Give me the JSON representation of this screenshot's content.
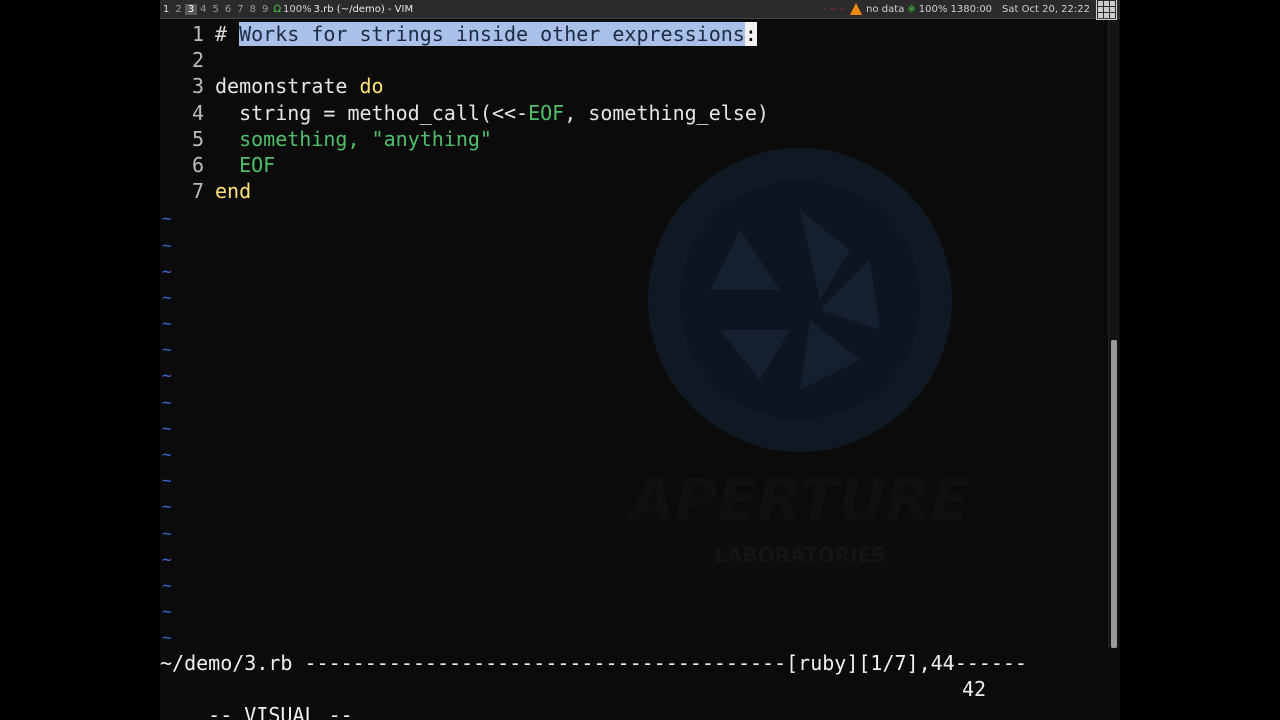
{
  "topbar": {
    "workspaces": [
      {
        "label": "1",
        "state": "occupied"
      },
      {
        "label": "2",
        "state": "normal"
      },
      {
        "label": "3",
        "state": "active"
      },
      {
        "label": "4",
        "state": "normal"
      },
      {
        "label": "5",
        "state": "normal"
      },
      {
        "label": "6",
        "state": "normal"
      },
      {
        "label": "7",
        "state": "normal"
      },
      {
        "label": "8",
        "state": "normal"
      },
      {
        "label": "9",
        "state": "normal"
      }
    ],
    "layout_icon": "layout-tall-icon",
    "master_ratio": "100%",
    "window_title": "3.rb (~/demo) - VIM",
    "cpu_graph_text": "- -- -",
    "media_icon": "vlc-cone-icon",
    "media_status": "no data",
    "battery_icon": "battery-plug-icon",
    "battery_text": "100% 1380:00",
    "clock": "Sat Oct 20, 22:22",
    "grid_icon": "grid-icon"
  },
  "editor": {
    "filetype": "ruby",
    "lines": [
      {
        "number": "1",
        "segments": [
          {
            "text": "# ",
            "class": "cm"
          },
          {
            "text": "Works for strings inside other expressions",
            "class": "sel"
          },
          {
            "text": ":",
            "class": "cursor-ch"
          },
          {
            "text": ":",
            "class": "cm"
          }
        ]
      },
      {
        "number": "2",
        "segments": []
      },
      {
        "number": "3",
        "segments": [
          {
            "text": "demonstrate ",
            "class": ""
          },
          {
            "text": "do",
            "class": "kw"
          }
        ]
      },
      {
        "number": "4",
        "segments": [
          {
            "text": "  string = method_call(<<-",
            "class": ""
          },
          {
            "text": "EOF",
            "class": "sym"
          },
          {
            "text": ", something_else)",
            "class": ""
          }
        ]
      },
      {
        "number": "5",
        "segments": [
          {
            "text": "  something, \"anything\"",
            "class": "str"
          }
        ]
      },
      {
        "number": "6",
        "segments": [
          {
            "text": "  EOF",
            "class": "sym"
          }
        ]
      },
      {
        "number": "7",
        "segments": [
          {
            "text": "end",
            "class": "kw"
          }
        ]
      }
    ],
    "empty_line_marker": "~",
    "empty_line_count": 17
  },
  "scrollbar": {
    "position_fraction": 0.51,
    "thumb_fraction": 0.49
  },
  "statusline": {
    "text": "~/demo/3.rb ----------------------------------------[ruby][1/7],44------"
  },
  "cmdline": {
    "mode": "-- VISUAL --",
    "selection_count": "42"
  },
  "background": {
    "logo_text": "APERTURE",
    "logo_subtext": "LABORATORIES"
  }
}
